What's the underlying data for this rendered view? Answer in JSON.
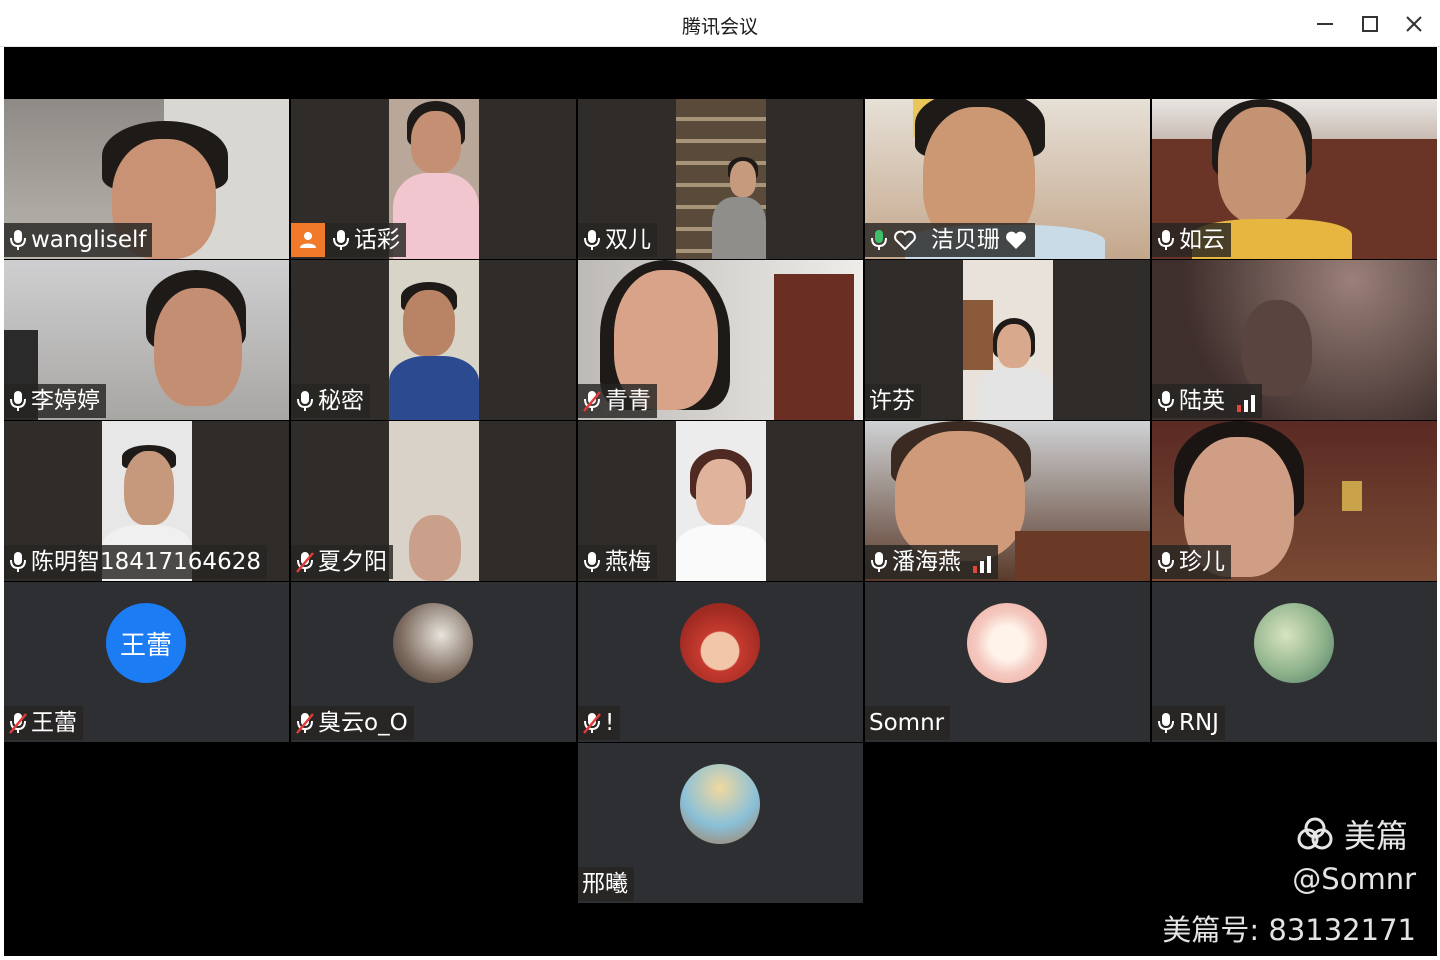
{
  "window": {
    "title": "腾讯会议"
  },
  "participants": [
    {
      "name": "wangliself",
      "mic": "on"
    },
    {
      "name": "话彩",
      "mic": "on",
      "host": true
    },
    {
      "name": "双儿",
      "mic": "on"
    },
    {
      "name": "洁贝珊",
      "mic": "speaking",
      "heart": true
    },
    {
      "name": "如云",
      "mic": "on"
    },
    {
      "name": "李婷婷",
      "mic": "on"
    },
    {
      "name": "秘密",
      "mic": "on"
    },
    {
      "name": "青青",
      "mic": "muted"
    },
    {
      "name": "许芬",
      "mic": "none"
    },
    {
      "name": "陆英",
      "mic": "on",
      "signal": "weak"
    },
    {
      "name": "陈明智18417164628",
      "mic": "on"
    },
    {
      "name": "夏夕阳",
      "mic": "muted"
    },
    {
      "name": "燕梅",
      "mic": "on"
    },
    {
      "name": "潘海燕",
      "mic": "on",
      "signal": "weak"
    },
    {
      "name": "珍儿",
      "mic": "on"
    },
    {
      "name": "王蕾",
      "mic": "muted",
      "avatar_text": "王蕾"
    },
    {
      "name": "臭云o_O",
      "mic": "muted"
    },
    {
      "name": "!",
      "mic": "muted"
    },
    {
      "name": "Somnr",
      "mic": "none"
    },
    {
      "name": "RNJ",
      "mic": "on"
    },
    {
      "name": "邢曦",
      "mic": "none"
    }
  ],
  "watermark": {
    "brand": "美篇",
    "handle": "@Somnr",
    "id_text": "美篇号: 83132171"
  },
  "colors": {
    "speaking": "#3fbf6a",
    "host_badge": "#f07a2a",
    "avatar_blue": "#1c7cf4",
    "muted_red": "#e23b3b",
    "signal_red": "#e0473b"
  }
}
